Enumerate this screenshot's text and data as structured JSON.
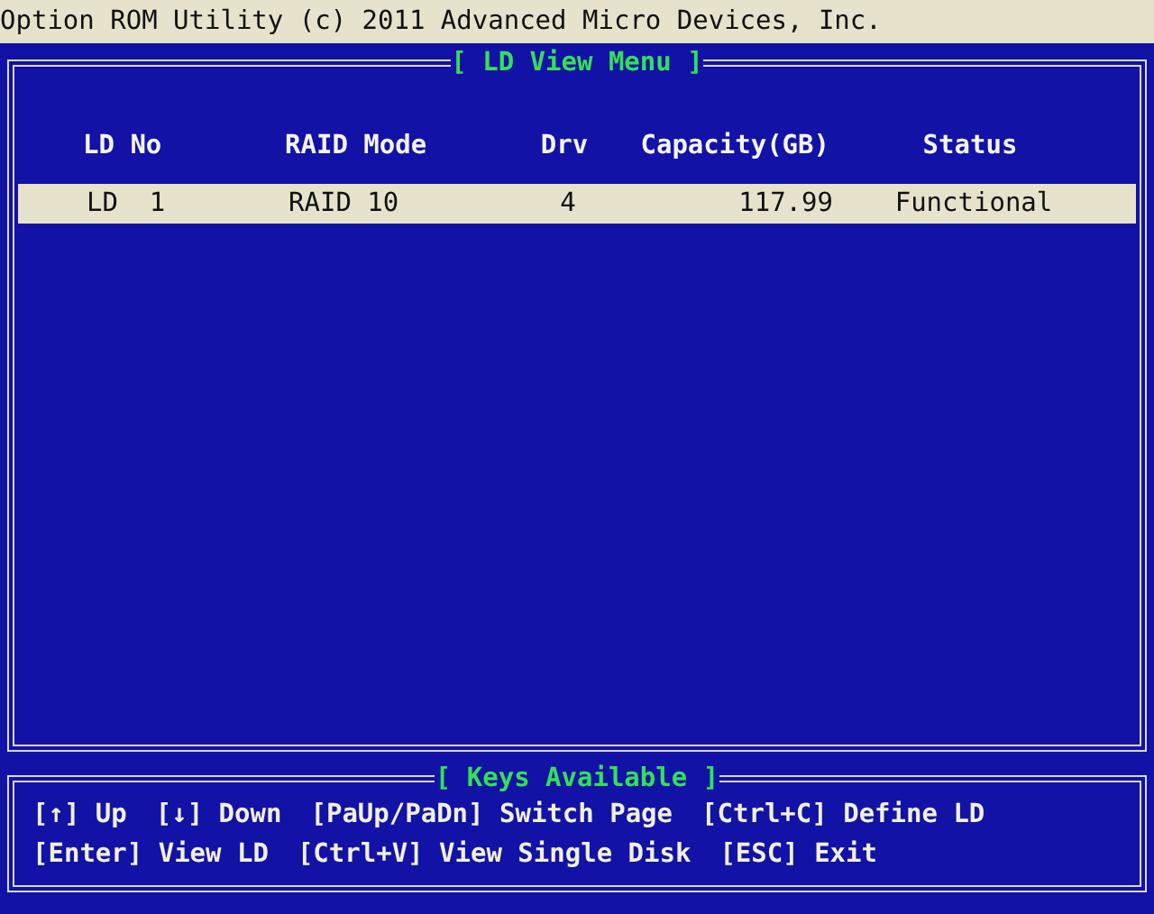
{
  "title_bar": {
    "title": "Option ROM Utility (c) 2011 Advanced Micro Devices, Inc."
  },
  "main_panel": {
    "title": "[ LD View Menu ]",
    "table": {
      "columns": [
        "LD No",
        "RAID Mode",
        "Drv",
        "Capacity(GB)",
        "Status"
      ],
      "rows": [
        {
          "cells": [
            "LD  1",
            "RAID 10",
            "4",
            "117.99",
            "Functional"
          ],
          "selected": true
        }
      ]
    }
  },
  "keys_panel": {
    "title": "[ Keys Available ]",
    "lines": [
      [
        "[↑] Up",
        "[↓] Down",
        "[PaUp/PaDn] Switch Page",
        "[Ctrl+C] Define LD"
      ],
      [
        "[Enter] View LD",
        "[Ctrl+V] View Single Disk",
        "[ESC] Exit"
      ]
    ]
  }
}
